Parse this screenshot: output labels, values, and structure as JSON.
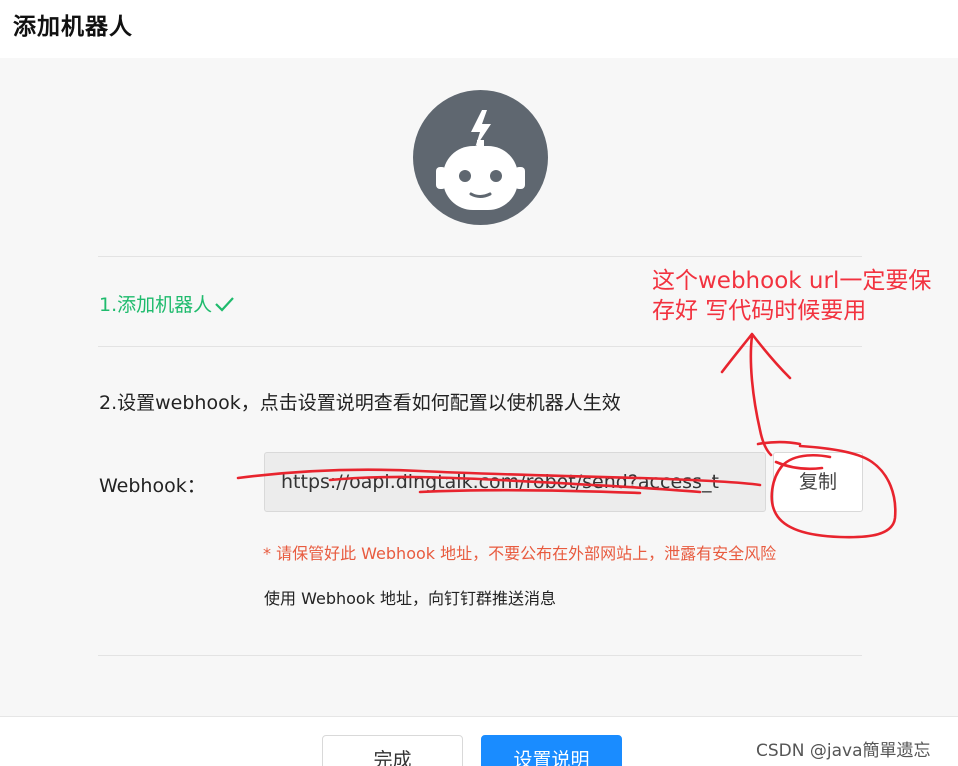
{
  "page": {
    "title": "添加机器人"
  },
  "steps": {
    "step1": "1.添加机器人",
    "step2": "2.设置webhook，点击设置说明查看如何配置以使机器人生效"
  },
  "webhook": {
    "label": "Webhook：",
    "value": "https://oapi.dingtalk.com/robot/send?access_t",
    "copy_label": "复制",
    "warning": "* 请保管好此 Webhook 地址，不要公布在外部网站上，泄露有安全风险",
    "usage": "使用 Webhook 地址，向钉钉群推送消息"
  },
  "annotation": {
    "line1": "这个webhook url一定要保",
    "line2": "存好 写代码时候要用"
  },
  "footer": {
    "done_label": "完成",
    "help_label": "设置说明"
  },
  "watermark": "CSDN @java簡單遗忘",
  "colors": {
    "success": "#1fbb6d",
    "warning": "#e85b3f",
    "primary": "#1a8cff",
    "annotation": "#f2323f",
    "avatar": "#5f6770"
  }
}
